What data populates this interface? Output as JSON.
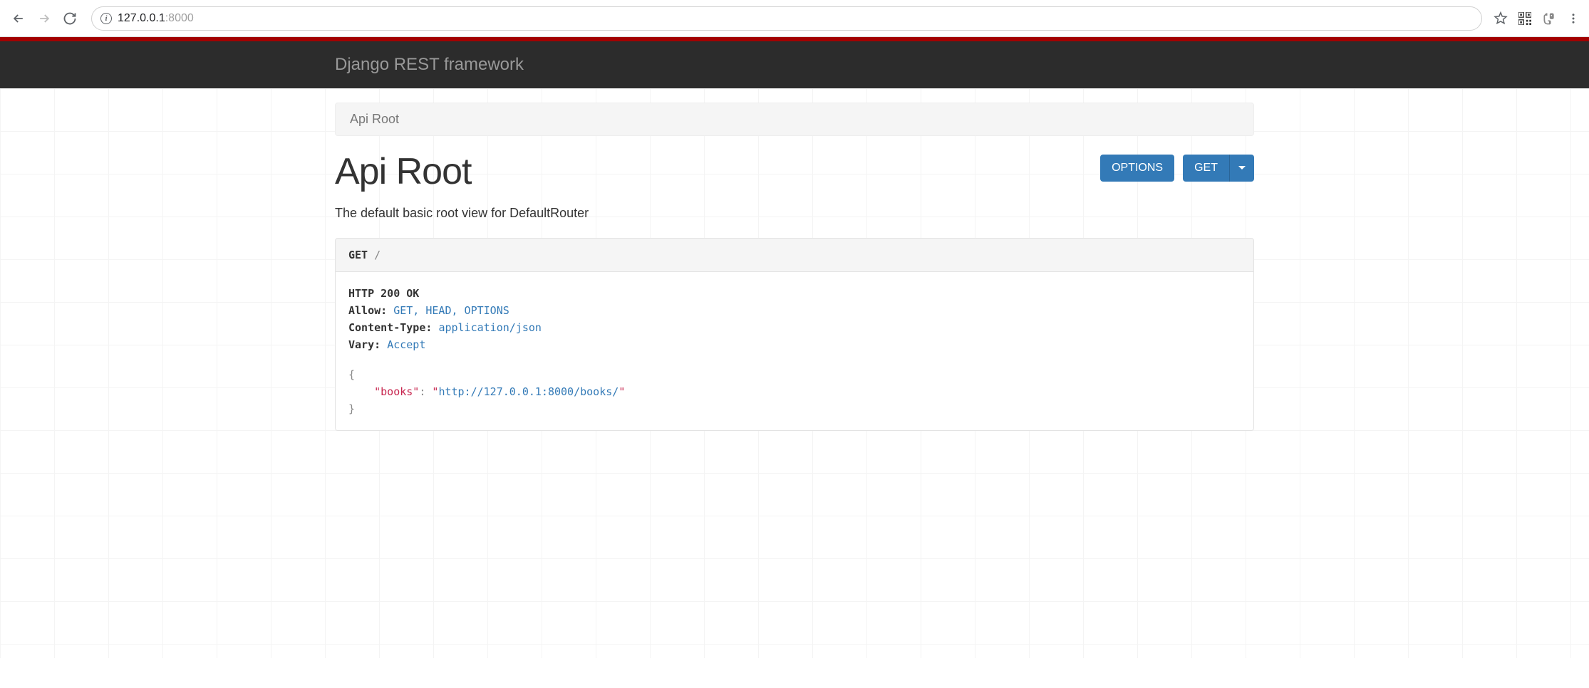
{
  "browser": {
    "url_host": "127.0.0.1",
    "url_port": ":8000"
  },
  "header": {
    "brand": "Django REST framework"
  },
  "breadcrumb": {
    "items": [
      "Api Root"
    ]
  },
  "page": {
    "title": "Api Root",
    "description": "The default basic root view for DefaultRouter"
  },
  "buttons": {
    "options": "OPTIONS",
    "get": "GET"
  },
  "request": {
    "method": "GET",
    "path": "/"
  },
  "response": {
    "status_line": "HTTP 200 OK",
    "headers": [
      {
        "name": "Allow:",
        "value": "GET, HEAD, OPTIONS"
      },
      {
        "name": "Content-Type:",
        "value": "application/json"
      },
      {
        "name": "Vary:",
        "value": "Accept"
      }
    ],
    "body": {
      "open": "{",
      "key": "\"books\"",
      "colon": ":",
      "value_quote_open": "\"",
      "value_url": "http://127.0.0.1:8000/books/",
      "value_quote_close": "\"",
      "close": "}"
    }
  }
}
